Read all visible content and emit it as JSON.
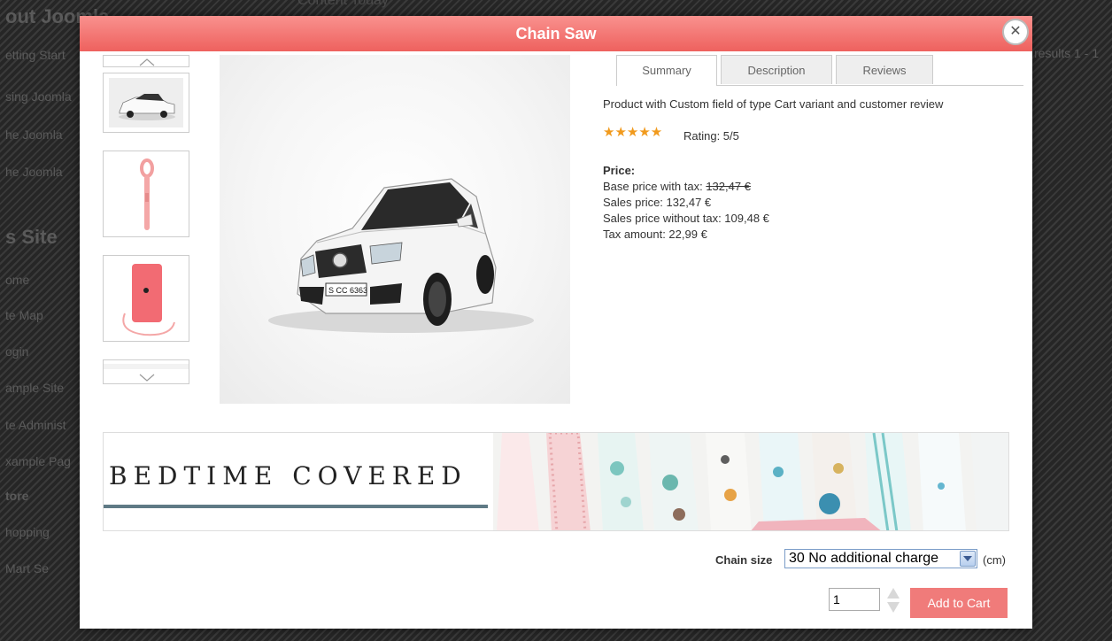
{
  "background": {
    "top_text": "Content Today",
    "sidebar_items": [
      "out Joomla",
      "etting Start",
      "sing Joomla",
      "he Joomla",
      "he Joomla",
      "s Site",
      "ome",
      "te Map",
      "ogin",
      "ample Site",
      "te Administ",
      "xample Pag",
      "tore",
      "hopping",
      "Mart Se",
      "results 1 - 1"
    ]
  },
  "modal": {
    "title": "Chain Saw",
    "close_icon": "close-icon"
  },
  "thumbnails": {
    "up_icon": "chevron-up-icon",
    "down_icon": "chevron-down-icon",
    "items": [
      "car",
      "pink lanyard",
      "pink ipod"
    ]
  },
  "tabs": [
    {
      "label": "Summary",
      "active": true
    },
    {
      "label": "Description",
      "active": false
    },
    {
      "label": "Reviews",
      "active": false
    }
  ],
  "summary": {
    "description": "Product with Custom field of type Cart variant and customer review",
    "stars": "★★★★★",
    "rating_value": 5,
    "rating_text": "Rating: 5/5",
    "price_label": "Price:",
    "base_price_label": "Base price with tax: ",
    "base_price_value": "132,47 €",
    "sales_price": "Sales price: 132,47 €",
    "sales_price_no_tax": "Sales price without tax: 109,48 €",
    "tax_amount": "Tax amount: 22,99 €"
  },
  "main_image": {
    "plate": "S CC 6363"
  },
  "banner": {
    "text": "BEDTIME COVERED"
  },
  "cart": {
    "chain_label": "Chain size",
    "chain_selected": "30 No additional charge",
    "chain_unit": "(cm)",
    "quantity": "1",
    "add_label": "Add to Cart"
  },
  "colors": {
    "header": "#f07b7a",
    "accent": "#f07b7a",
    "stars": "#f19a1d"
  }
}
